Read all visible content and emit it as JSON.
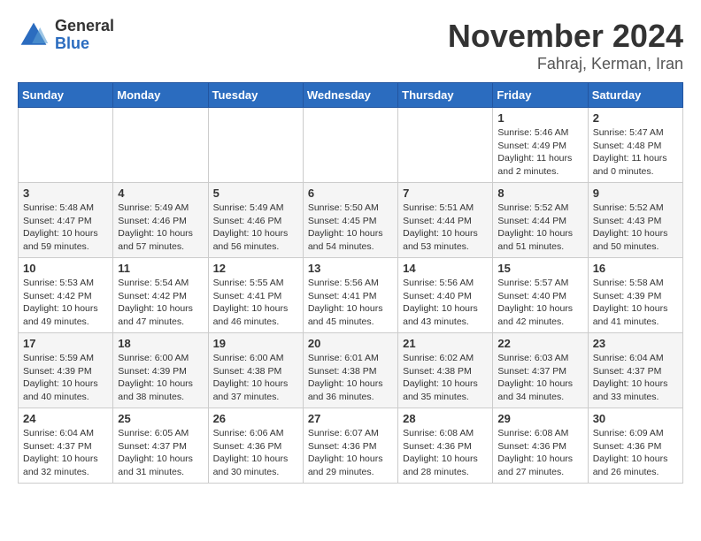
{
  "logo": {
    "general": "General",
    "blue": "Blue"
  },
  "header": {
    "month": "November 2024",
    "location": "Fahraj, Kerman, Iran"
  },
  "weekdays": [
    "Sunday",
    "Monday",
    "Tuesday",
    "Wednesday",
    "Thursday",
    "Friday",
    "Saturday"
  ],
  "weeks": [
    [
      {
        "day": "",
        "info": ""
      },
      {
        "day": "",
        "info": ""
      },
      {
        "day": "",
        "info": ""
      },
      {
        "day": "",
        "info": ""
      },
      {
        "day": "",
        "info": ""
      },
      {
        "day": "1",
        "info": "Sunrise: 5:46 AM\nSunset: 4:49 PM\nDaylight: 11 hours and 2 minutes."
      },
      {
        "day": "2",
        "info": "Sunrise: 5:47 AM\nSunset: 4:48 PM\nDaylight: 11 hours and 0 minutes."
      }
    ],
    [
      {
        "day": "3",
        "info": "Sunrise: 5:48 AM\nSunset: 4:47 PM\nDaylight: 10 hours and 59 minutes."
      },
      {
        "day": "4",
        "info": "Sunrise: 5:49 AM\nSunset: 4:46 PM\nDaylight: 10 hours and 57 minutes."
      },
      {
        "day": "5",
        "info": "Sunrise: 5:49 AM\nSunset: 4:46 PM\nDaylight: 10 hours and 56 minutes."
      },
      {
        "day": "6",
        "info": "Sunrise: 5:50 AM\nSunset: 4:45 PM\nDaylight: 10 hours and 54 minutes."
      },
      {
        "day": "7",
        "info": "Sunrise: 5:51 AM\nSunset: 4:44 PM\nDaylight: 10 hours and 53 minutes."
      },
      {
        "day": "8",
        "info": "Sunrise: 5:52 AM\nSunset: 4:44 PM\nDaylight: 10 hours and 51 minutes."
      },
      {
        "day": "9",
        "info": "Sunrise: 5:52 AM\nSunset: 4:43 PM\nDaylight: 10 hours and 50 minutes."
      }
    ],
    [
      {
        "day": "10",
        "info": "Sunrise: 5:53 AM\nSunset: 4:42 PM\nDaylight: 10 hours and 49 minutes."
      },
      {
        "day": "11",
        "info": "Sunrise: 5:54 AM\nSunset: 4:42 PM\nDaylight: 10 hours and 47 minutes."
      },
      {
        "day": "12",
        "info": "Sunrise: 5:55 AM\nSunset: 4:41 PM\nDaylight: 10 hours and 46 minutes."
      },
      {
        "day": "13",
        "info": "Sunrise: 5:56 AM\nSunset: 4:41 PM\nDaylight: 10 hours and 45 minutes."
      },
      {
        "day": "14",
        "info": "Sunrise: 5:56 AM\nSunset: 4:40 PM\nDaylight: 10 hours and 43 minutes."
      },
      {
        "day": "15",
        "info": "Sunrise: 5:57 AM\nSunset: 4:40 PM\nDaylight: 10 hours and 42 minutes."
      },
      {
        "day": "16",
        "info": "Sunrise: 5:58 AM\nSunset: 4:39 PM\nDaylight: 10 hours and 41 minutes."
      }
    ],
    [
      {
        "day": "17",
        "info": "Sunrise: 5:59 AM\nSunset: 4:39 PM\nDaylight: 10 hours and 40 minutes."
      },
      {
        "day": "18",
        "info": "Sunrise: 6:00 AM\nSunset: 4:39 PM\nDaylight: 10 hours and 38 minutes."
      },
      {
        "day": "19",
        "info": "Sunrise: 6:00 AM\nSunset: 4:38 PM\nDaylight: 10 hours and 37 minutes."
      },
      {
        "day": "20",
        "info": "Sunrise: 6:01 AM\nSunset: 4:38 PM\nDaylight: 10 hours and 36 minutes."
      },
      {
        "day": "21",
        "info": "Sunrise: 6:02 AM\nSunset: 4:38 PM\nDaylight: 10 hours and 35 minutes."
      },
      {
        "day": "22",
        "info": "Sunrise: 6:03 AM\nSunset: 4:37 PM\nDaylight: 10 hours and 34 minutes."
      },
      {
        "day": "23",
        "info": "Sunrise: 6:04 AM\nSunset: 4:37 PM\nDaylight: 10 hours and 33 minutes."
      }
    ],
    [
      {
        "day": "24",
        "info": "Sunrise: 6:04 AM\nSunset: 4:37 PM\nDaylight: 10 hours and 32 minutes."
      },
      {
        "day": "25",
        "info": "Sunrise: 6:05 AM\nSunset: 4:37 PM\nDaylight: 10 hours and 31 minutes."
      },
      {
        "day": "26",
        "info": "Sunrise: 6:06 AM\nSunset: 4:36 PM\nDaylight: 10 hours and 30 minutes."
      },
      {
        "day": "27",
        "info": "Sunrise: 6:07 AM\nSunset: 4:36 PM\nDaylight: 10 hours and 29 minutes."
      },
      {
        "day": "28",
        "info": "Sunrise: 6:08 AM\nSunset: 4:36 PM\nDaylight: 10 hours and 28 minutes."
      },
      {
        "day": "29",
        "info": "Sunrise: 6:08 AM\nSunset: 4:36 PM\nDaylight: 10 hours and 27 minutes."
      },
      {
        "day": "30",
        "info": "Sunrise: 6:09 AM\nSunset: 4:36 PM\nDaylight: 10 hours and 26 minutes."
      }
    ]
  ]
}
